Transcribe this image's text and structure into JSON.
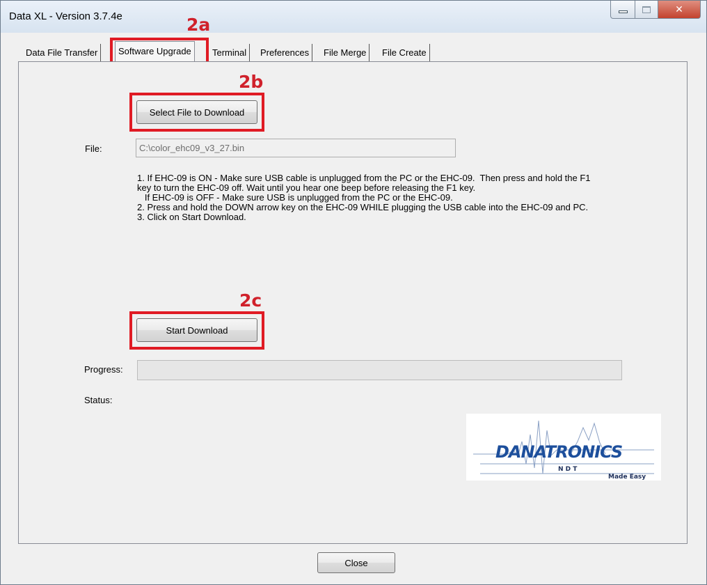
{
  "window": {
    "title": "Data XL - Version 3.7.4e",
    "close_glyph": "✕"
  },
  "annotations": {
    "a": "2a",
    "b": "2b",
    "c": "2c",
    "color": "#e01b24"
  },
  "tabs": [
    {
      "label": "Data File Transfer",
      "active": false
    },
    {
      "label": "Software Upgrade",
      "active": true
    },
    {
      "label": "Terminal",
      "active": false
    },
    {
      "label": "Preferences",
      "active": false
    },
    {
      "label": "File Merge",
      "active": false
    },
    {
      "label": "File Create",
      "active": false
    }
  ],
  "upgrade": {
    "select_button": "Select File to Download",
    "file_label": "File:",
    "file_value": "C:\\color_ehc09_v3_27.bin",
    "instructions": [
      "1. If EHC-09 is ON - Make sure USB cable is unplugged from the PC or the EHC-09.  Then press and hold the F1",
      "key to turn the EHC-09 off. Wait until you hear one beep before releasing the F1 key.",
      "   If EHC-09 is OFF - Make sure USB is unplugged from the PC or the EHC-09.",
      "2. Press and hold the DOWN arrow key on the EHC-09 WHILE plugging the USB cable into the EHC-09 and PC.",
      "3. Click on Start Download."
    ],
    "start_button": "Start Download",
    "progress_label": "Progress:",
    "progress_value": 0,
    "status_label": "Status:"
  },
  "logo": {
    "brand": "DANATRONICS",
    "sub": "N D T",
    "tagline": "Made Easy"
  },
  "footer": {
    "close_button": "Close"
  }
}
